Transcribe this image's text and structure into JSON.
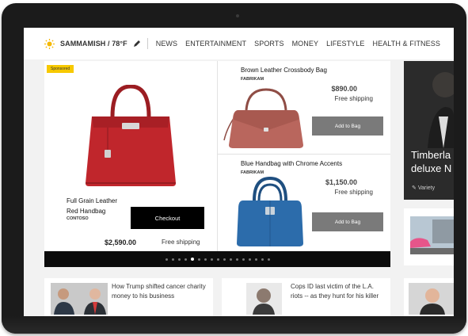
{
  "header": {
    "location": "SAMMAMISH / 78°F",
    "nav": [
      "NEWS",
      "ENTERTAINMENT",
      "SPORTS",
      "MONEY",
      "LIFESTYLE",
      "HEALTH & FITNESS"
    ]
  },
  "hero": {
    "badge": "Sponsored",
    "main_product": {
      "title_line1": "Full Grain Leather",
      "title_line2": "Red Handbag",
      "brand": "CONTOSO",
      "price": "$2,590.00",
      "shipping": "Free shipping",
      "button": "Checkout"
    },
    "products": [
      {
        "title": "Brown Leather Crossbody Bag",
        "brand": "FABRIKAM",
        "price": "$890.00",
        "shipping": "Free shipping",
        "button": "Add to Bag"
      },
      {
        "title": "Blue Handbag with Chrome Accents",
        "brand": "FABRIKAM",
        "price": "$1,150.00",
        "shipping": "Free shipping",
        "button": "Add to Bag"
      }
    ],
    "carousel": {
      "total": 17,
      "active": 4
    }
  },
  "side_tile": {
    "title_line1": "Timberla",
    "title_line2": "deluxe N",
    "source": "Variety"
  },
  "news": [
    {
      "headline": "How Trump shifted cancer charity money to his business"
    },
    {
      "headline": "Cops ID last victim of the L.A. riots -- as they hunt for his killer"
    }
  ],
  "colors": {
    "badge": "#f7c900",
    "checkout_bg": "#000000",
    "add_to_bag_bg": "#7a7a7a",
    "bag_red": "#c0262c",
    "bag_brown": "#b9665d",
    "bag_blue": "#2c6cab"
  }
}
